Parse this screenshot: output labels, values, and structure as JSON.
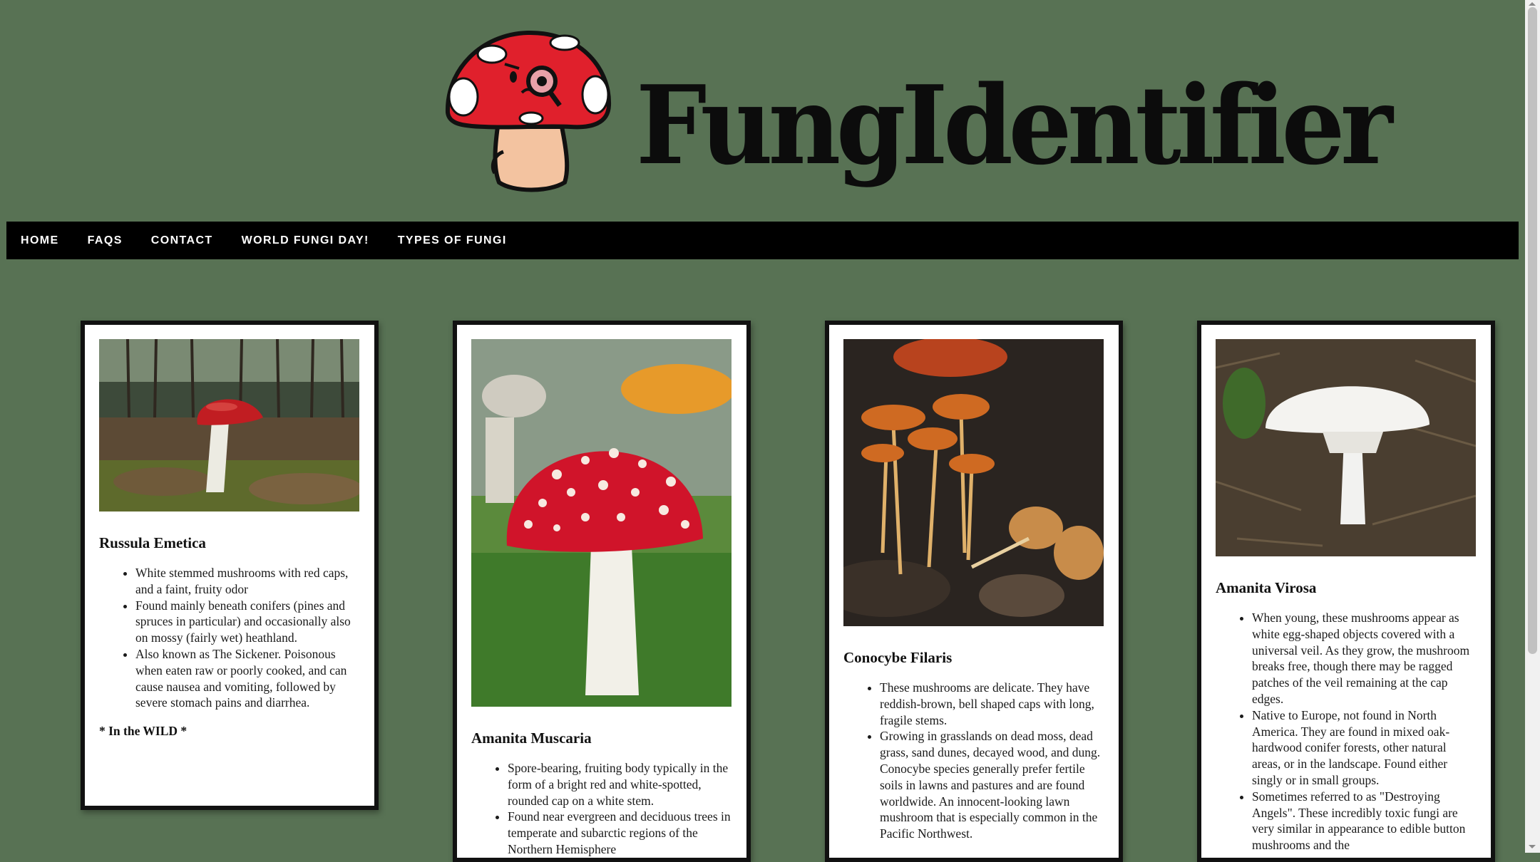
{
  "site": {
    "logo_text": "FungIdentifier"
  },
  "nav": {
    "items": [
      {
        "label": "HOME"
      },
      {
        "label": "FAQS"
      },
      {
        "label": "CONTACT"
      },
      {
        "label": "WORLD FUNGI DAY!"
      },
      {
        "label": "TYPES OF FUNGI"
      }
    ]
  },
  "cards": [
    {
      "title": "Russula Emetica",
      "bullets": [
        "White stemmed mushrooms with red caps, and a faint, fruity odor",
        "Found mainly beneath conifers (pines and spruces in particular) and occasionally also on mossy (fairly wet) heathland.",
        "Also known as The Sickener. Poisonous when eaten raw or poorly cooked, and can cause nausea and vomiting, followed by severe stomach pains and diarrhea."
      ],
      "footer": "* In the WILD *"
    },
    {
      "title": "Amanita Muscaria",
      "bullets": [
        "Spore-bearing, fruiting body typically in the form of a bright red and white-spotted, rounded cap on a white stem.",
        "Found near evergreen and deciduous trees in temperate and subarctic regions of the Northern Hemisphere"
      ]
    },
    {
      "title": "Conocybe Filaris",
      "bullets": [
        "These mushrooms are delicate. They have reddish-brown, bell shaped caps with long, fragile stems.",
        "Growing in grasslands on dead moss, dead grass, sand dunes, decayed wood, and dung. Conocybe species generally prefer fertile soils in lawns and pastures and are found worldwide. An innocent-looking lawn mushroom that is especially common in the Pacific Northwest."
      ]
    },
    {
      "title": "Amanita Virosa",
      "bullets": [
        "When young, these mushrooms appear as white egg-shaped objects covered with a universal veil. As they grow, the mushroom breaks free, though there may be ragged patches of the veil remaining at the cap edges.",
        "Native to Europe, not found in North America. They are found in mixed oak-hardwood conifer forests, other natural areas, or in the landscape. Found either singly or in small groups.",
        "Sometimes referred to as \"Destroying Angels\". These incredibly toxic fungi are very similar in appearance to edible button mushrooms and the"
      ]
    }
  ],
  "colors": {
    "background": "#587254",
    "nav_bg": "#000000",
    "card_border": "#111111",
    "mascot_cap": "#e0202c"
  }
}
